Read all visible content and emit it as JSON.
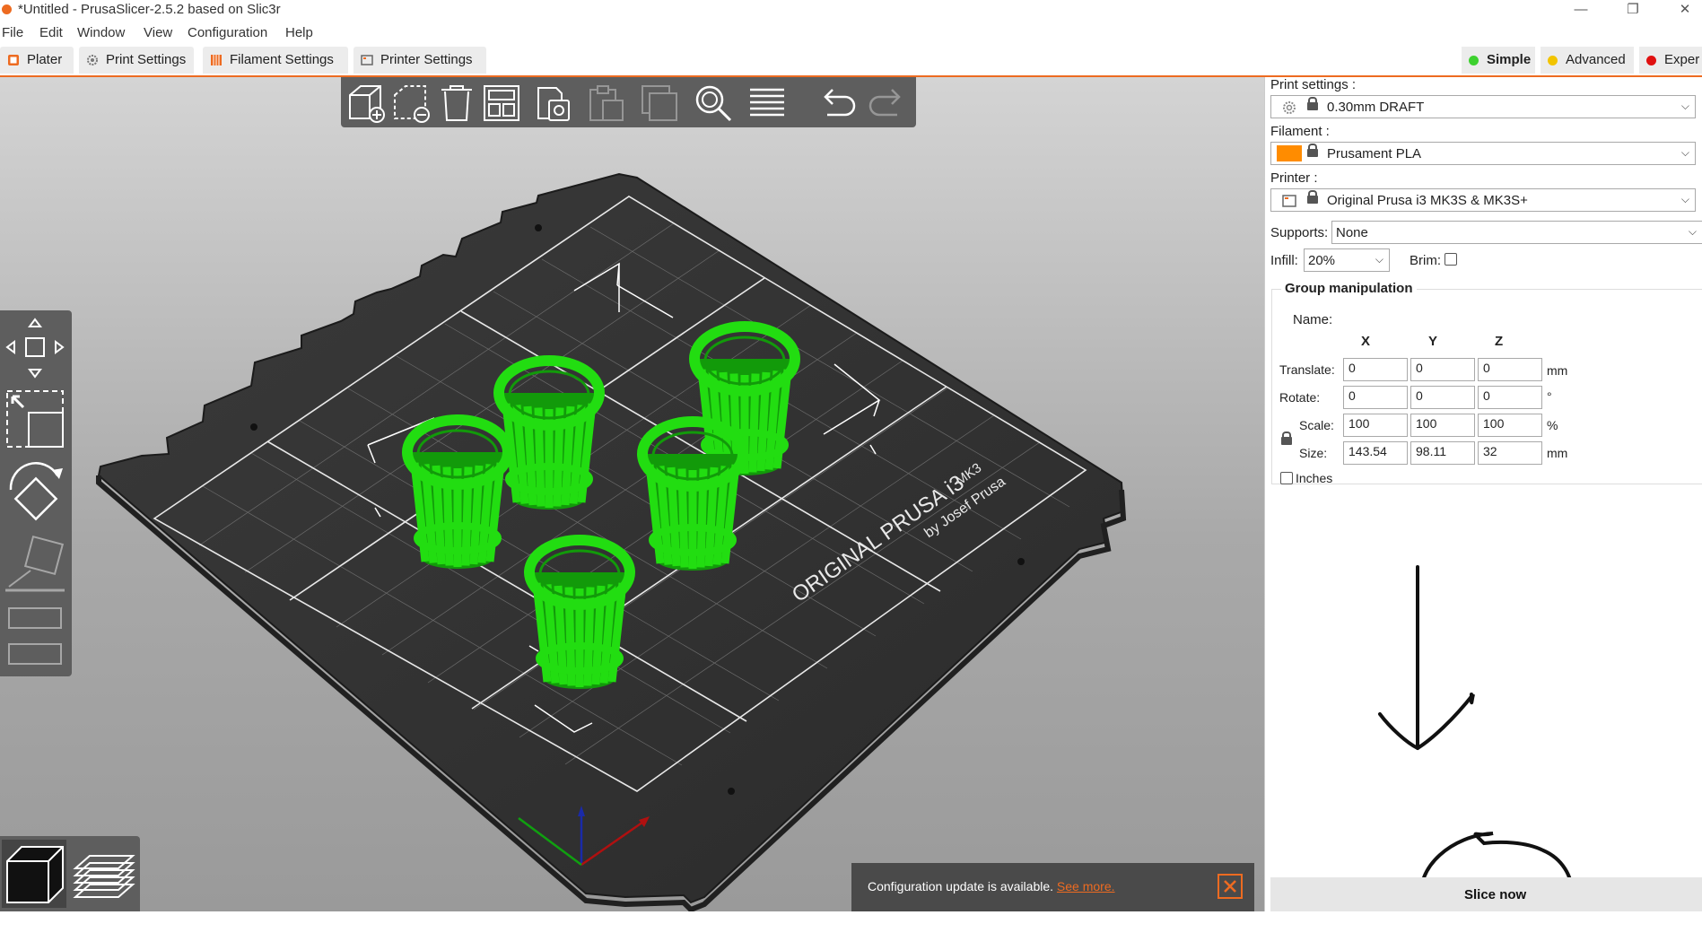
{
  "window": {
    "title": "*Untitled - PrusaSlicer-2.5.2 based on Slic3r",
    "minimize": "—",
    "restore": "❐",
    "close": "✕"
  },
  "menu": [
    "File",
    "Edit",
    "Window",
    "View",
    "Configuration",
    "Help"
  ],
  "tabs": {
    "plater": "Plater",
    "print_settings": "Print Settings",
    "filament_settings": "Filament Settings",
    "printer_settings": "Printer Settings"
  },
  "modes": {
    "simple": "Simple",
    "advanced": "Advanced",
    "expert": "Exper"
  },
  "colors": {
    "accent": "#ed6b21",
    "model_green": "#22dd11",
    "simple_dot": "#3dd12f",
    "advanced_dot": "#f2c400",
    "expert_dot": "#e01010",
    "filament_swatch": "#ff8c00"
  },
  "toolbar_icons": [
    "add-icon",
    "delete-icon",
    "delete-all-icon",
    "arrange-icon",
    "copy-icon",
    "paste-icon",
    "add-instance-icon",
    "search-icon",
    "layers-editing-icon",
    "undo-icon",
    "redo-icon"
  ],
  "bed": {
    "brand_line1": "ORIGINAL PRUSA i3",
    "brand_mk": "MK3",
    "brand_line2": "by Josef Prusa"
  },
  "notification": {
    "message": "Configuration update is available.",
    "link": "See more."
  },
  "sidebar": {
    "print_settings_label": "Print settings :",
    "print_settings_value": "0.30mm DRAFT",
    "filament_label": "Filament :",
    "filament_value": "Prusament PLA",
    "printer_label": "Printer :",
    "printer_value": "Original Prusa i3 MK3S & MK3S+",
    "supports_label": "Supports:",
    "supports_value": "None",
    "infill_label": "Infill:",
    "infill_value": "20%",
    "brim_label": "Brim:",
    "group_title": "Group manipulation",
    "name_label": "Name:",
    "axes": [
      "X",
      "Y",
      "Z"
    ],
    "translate_label": "Translate:",
    "translate": [
      "0",
      "0",
      "0"
    ],
    "translate_unit": "mm",
    "rotate_label": "Rotate:",
    "rotate": [
      "0",
      "0",
      "0"
    ],
    "rotate_unit": "°",
    "scale_label": "Scale:",
    "scale": [
      "100",
      "100",
      "100"
    ],
    "scale_unit": "%",
    "size_label": "Size:",
    "size": [
      "143.54",
      "98.11",
      "32"
    ],
    "size_unit": "mm",
    "inches_label": "Inches",
    "slice_button": "Slice now"
  }
}
